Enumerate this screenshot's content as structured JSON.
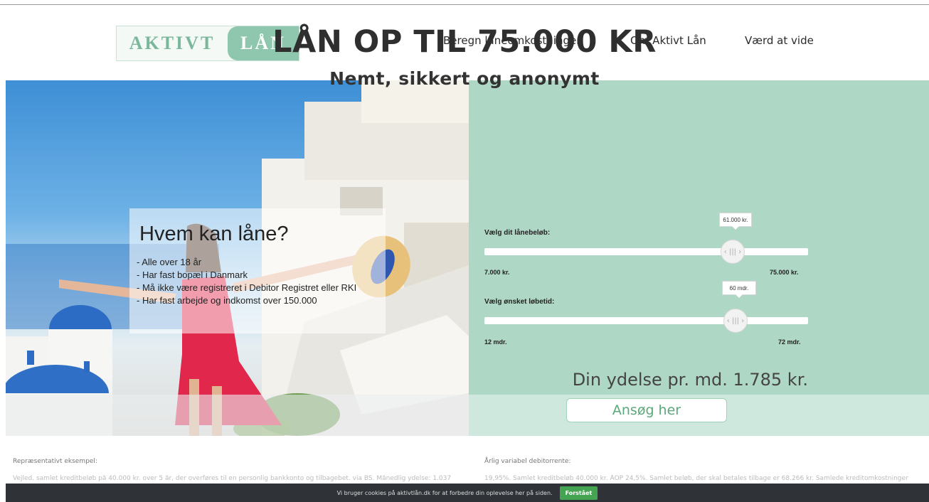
{
  "header": {
    "logo_left": "AKTIVT",
    "logo_right": "LÅN",
    "nav": [
      "Beregn låneomkostninger",
      "Om Aktivt Lån",
      "Værd at vide"
    ]
  },
  "hero": {
    "title": "LÅN OP TIL 75.000 KR",
    "subtitle": "Nemt, sikkert og anonymt",
    "info_box": {
      "title": "Hvem kan låne?",
      "lines": [
        "- Alle over 18 år",
        "- Har fast bopæl i Danmark",
        "- Må ikke være registreret i Debitor Registret eller RKI",
        "- Har fast arbejde og indkomst over 150.000"
      ]
    }
  },
  "calculator": {
    "amount": {
      "label": "Vælg dit lånebeløb:",
      "value_text": "61.000 kr.",
      "min": "7.000 kr.",
      "max": "75.000 kr.",
      "value": 61000,
      "range": [
        7000,
        75000
      ]
    },
    "term": {
      "label": "Vælg ønsket løbetid:",
      "value_text": "60 mdr.",
      "min": "12 mdr.",
      "max": "72 mdr.",
      "value": 60,
      "range": [
        12,
        72
      ]
    },
    "thumb_glyph": "‹ ||| ›",
    "payment": "Din ydelse pr. md. 1.785 kr.",
    "apply_label": "Ansøg her"
  },
  "lower": {
    "left_label": "Repræsentativt eksempel:",
    "left_text": "Vejled. samlet kreditbeløb på 40.000 kr. over 5 år, der overføres til en personlig bankkonto og tilbagebet. via BS. Månedlig ydelse: 1.037",
    "right_label": "Årlig variabel debitorrente:",
    "right_text": "19,95%. Samlet kreditbeløb 40.000 kr. ÅOP 24,5%. Samlet beløb, der skal betales tilbage er 68.266 kr. Samlede kreditomkostninger"
  },
  "cookie": {
    "text": "Vi bruger cookies på aktivtlån.dk for at forbedre din oplevelse her på siden.",
    "button": "Forstået"
  },
  "colors": {
    "brand_green": "#8ec7ad",
    "calculator_bg": "#afd7c6",
    "button_text": "#5aa97a",
    "cookie_btn": "#44a451"
  }
}
